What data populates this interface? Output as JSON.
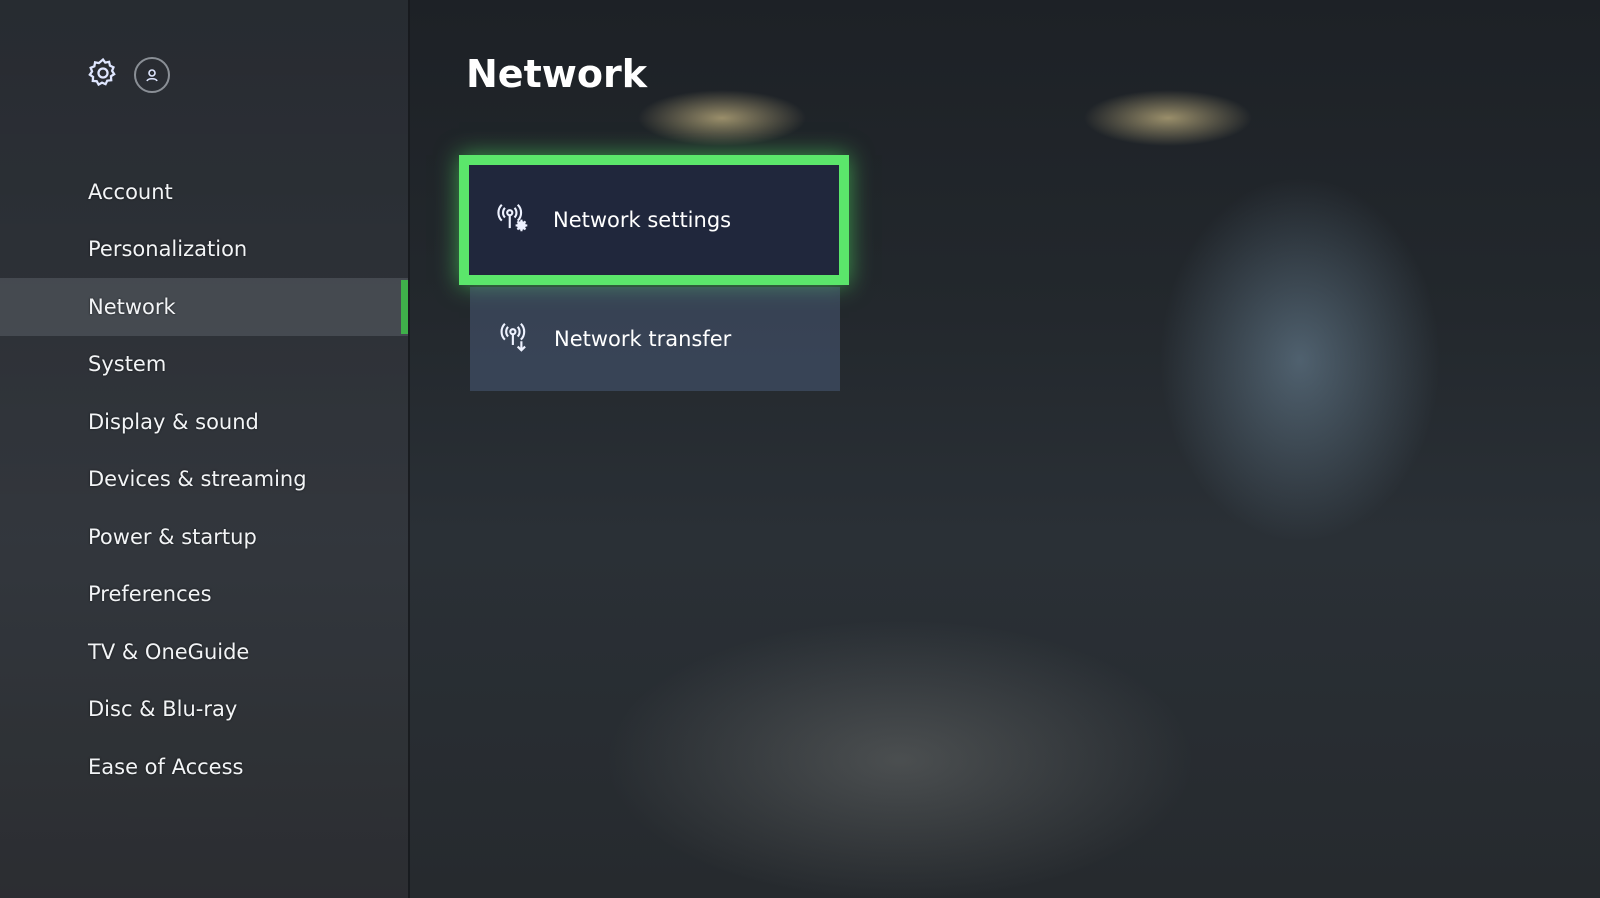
{
  "header": {
    "icons": [
      "gear-icon",
      "profile-icon"
    ]
  },
  "sidebar": {
    "items": [
      {
        "label": "Account"
      },
      {
        "label": "Personalization"
      },
      {
        "label": "Network",
        "selected": true
      },
      {
        "label": "System"
      },
      {
        "label": "Display & sound"
      },
      {
        "label": "Devices & streaming"
      },
      {
        "label": "Power & startup"
      },
      {
        "label": "Preferences"
      },
      {
        "label": "TV & OneGuide"
      },
      {
        "label": "Disc & Blu-ray"
      },
      {
        "label": "Ease of Access"
      }
    ]
  },
  "main": {
    "title": "Network",
    "tiles": [
      {
        "label": "Network settings",
        "icon": "network-settings-icon",
        "focused": true
      },
      {
        "label": "Network transfer",
        "icon": "network-transfer-icon",
        "focused": false
      }
    ]
  },
  "colors": {
    "accent": "#3fb04a",
    "focus_border": "#5be66b"
  }
}
